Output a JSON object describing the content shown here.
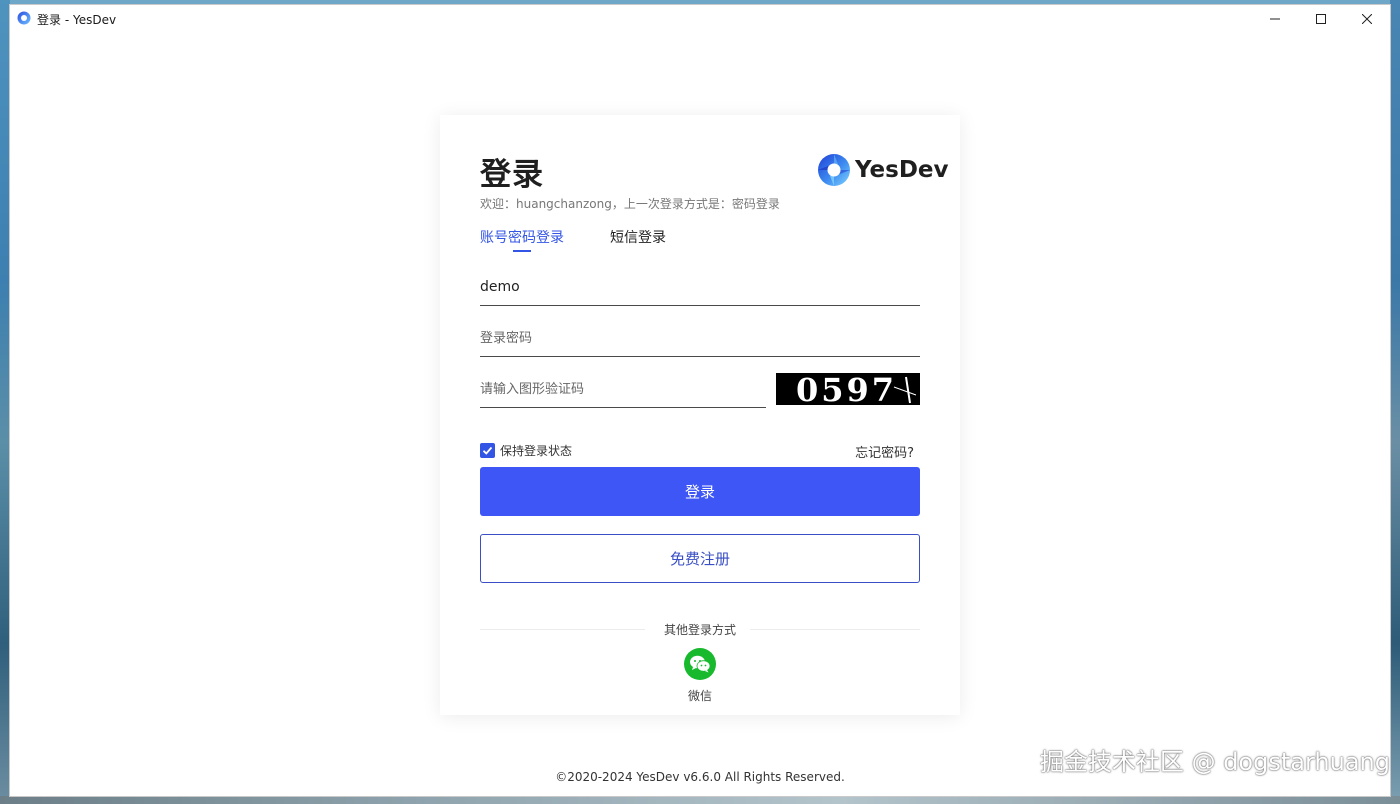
{
  "window": {
    "title": "登录 - YesDev",
    "minimize_icon": "minimize-icon",
    "maximize_icon": "maximize-icon",
    "close_icon": "close-icon"
  },
  "login": {
    "title": "登录",
    "brand_name": "YesDev",
    "welcome": "欢迎：huangchanzong，上一次登录方式是：密码登录",
    "tabs": [
      {
        "label": "账号密码登录",
        "active": true
      },
      {
        "label": "短信登录",
        "active": false
      }
    ],
    "username": {
      "value": "demo",
      "placeholder": ""
    },
    "password": {
      "value": "",
      "placeholder": "登录密码"
    },
    "captcha": {
      "value": "",
      "placeholder": "请输入图形验证码",
      "image_text": "0597"
    },
    "remember_label": "保持登录状态",
    "remember_checked": true,
    "forgot_label": "忘记密码?",
    "login_button": "登录",
    "register_button": "免费注册",
    "other_methods_label": "其他登录方式",
    "wechat_label": "微信"
  },
  "footer": {
    "copyright": "©2020-2024 YesDev v6.6.0 All Rights Reserved."
  },
  "watermark": "掘金技术社区 @ dogstarhuang",
  "colors": {
    "accent": "#3d56f5",
    "register_border": "#3a4fc6",
    "wechat": "#18b92d"
  }
}
